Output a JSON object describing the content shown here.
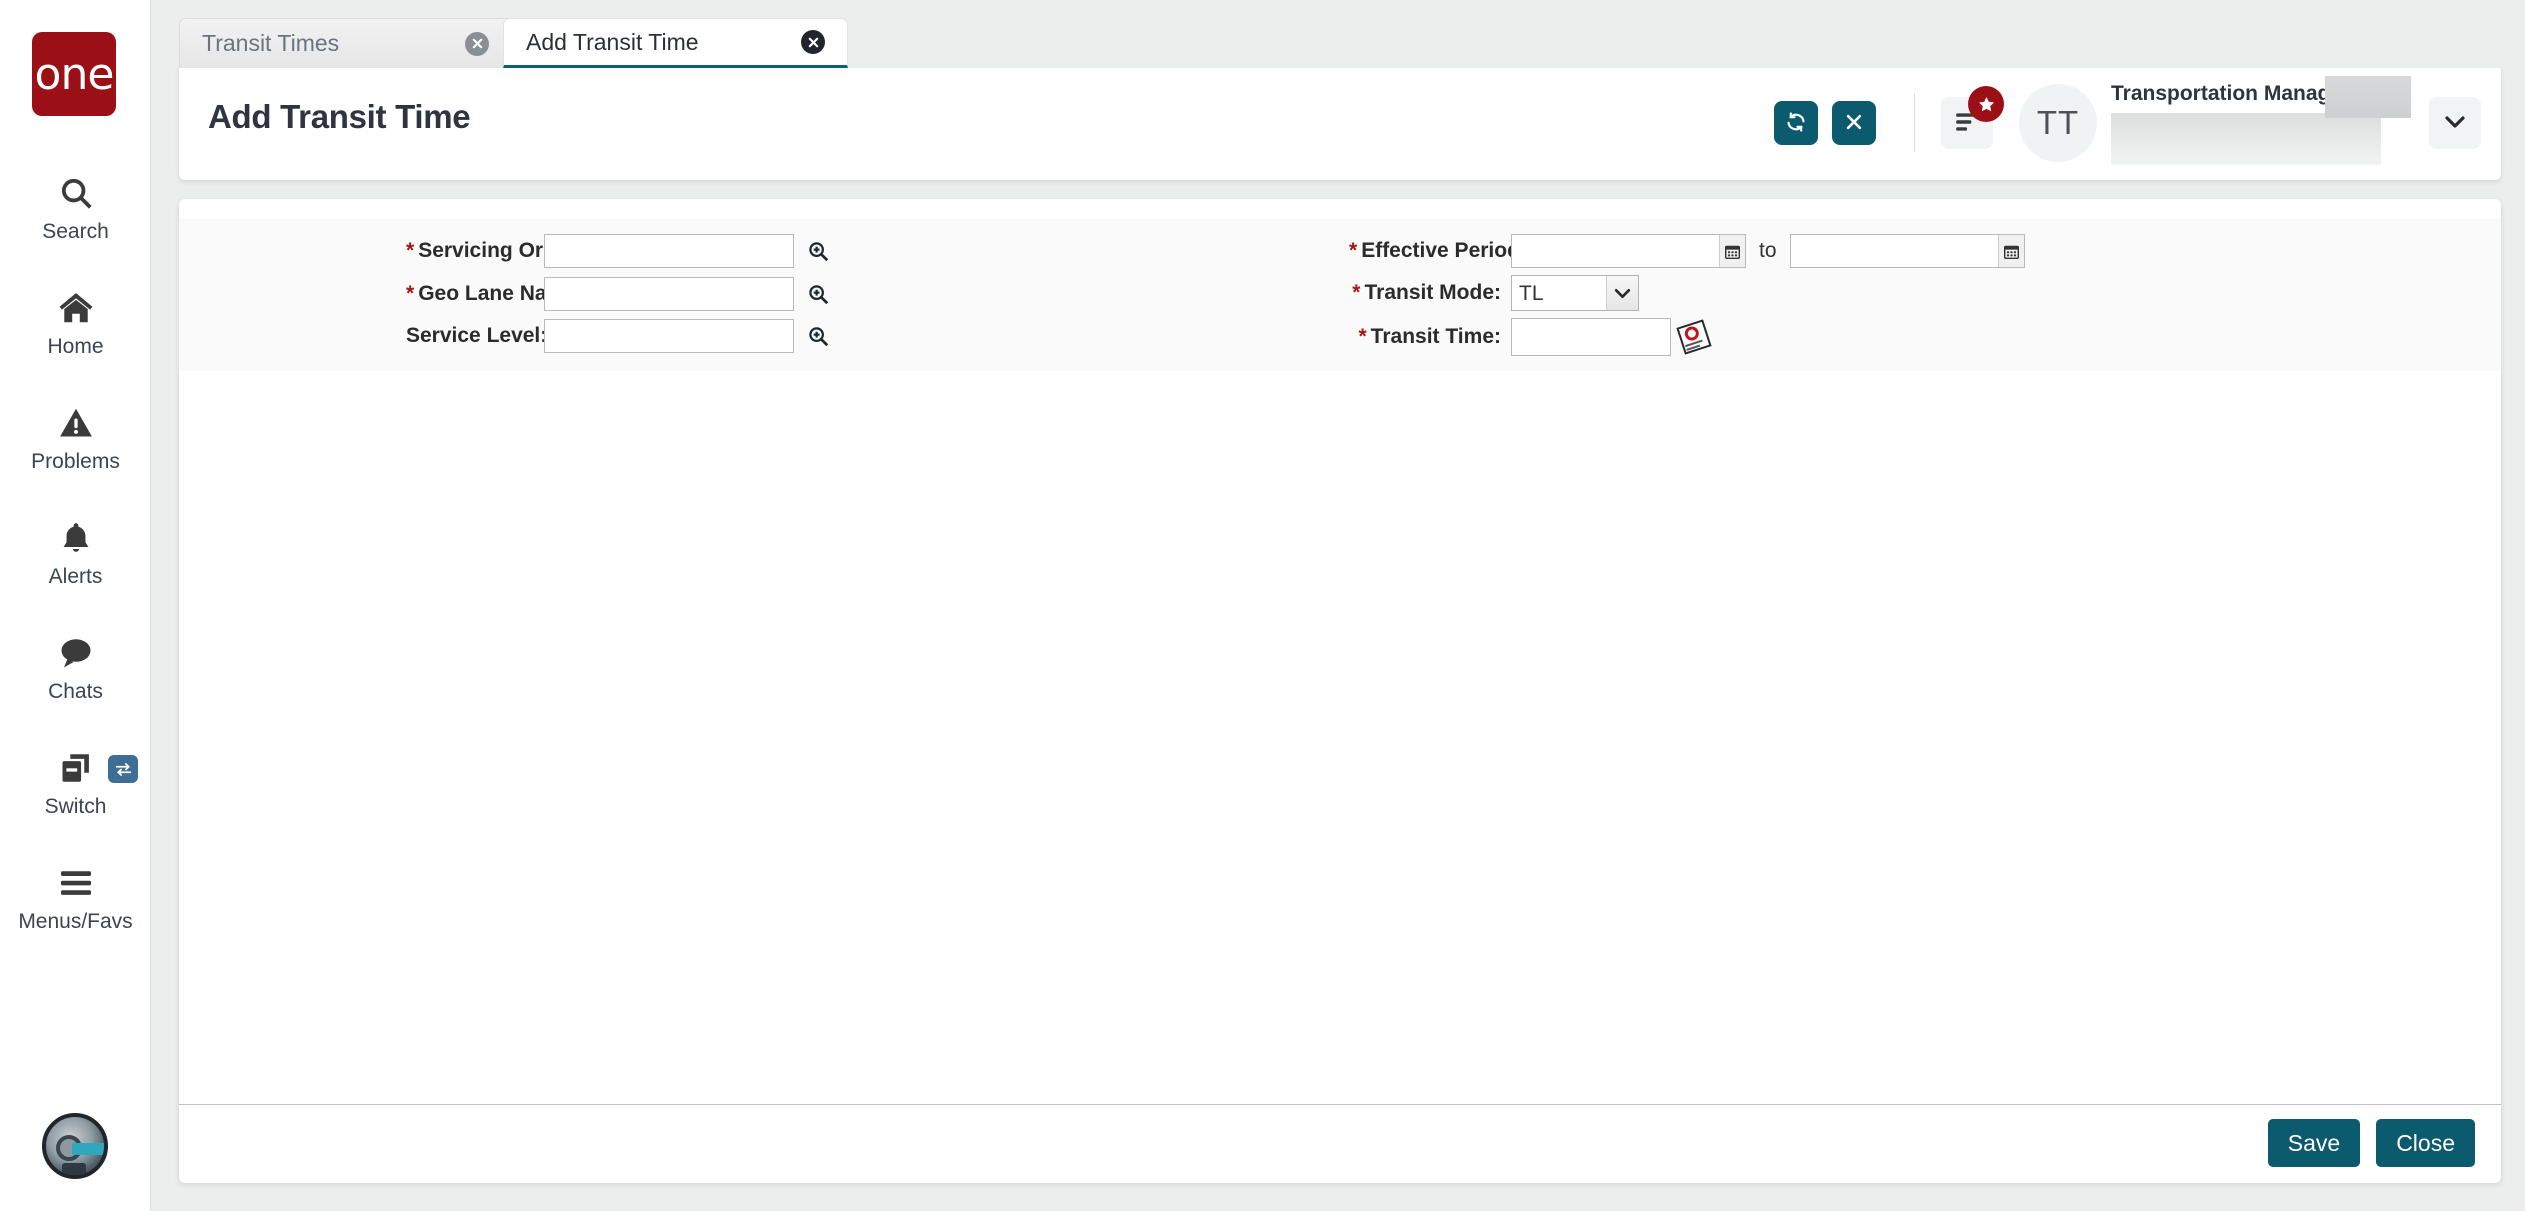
{
  "brand": {
    "logo_text": "one"
  },
  "sidebar": {
    "items": [
      {
        "label": "Search",
        "icon": "search-icon"
      },
      {
        "label": "Home",
        "icon": "home-icon"
      },
      {
        "label": "Problems",
        "icon": "warning-triangle-icon"
      },
      {
        "label": "Alerts",
        "icon": "bell-icon"
      },
      {
        "label": "Chats",
        "icon": "chat-bubble-icon"
      },
      {
        "label": "Switch",
        "icon": "switch-windows-icon",
        "badge_icon": "swap-arrows-icon"
      },
      {
        "label": "Menus/Favs",
        "icon": "hamburger-icon"
      }
    ],
    "assistant_avatar": "robot-avatar-icon"
  },
  "tabs": [
    {
      "label": "Transit Times",
      "active": false,
      "close_icon": "close-circle-icon"
    },
    {
      "label": "Add Transit Time",
      "active": true,
      "close_icon": "close-circle-icon"
    }
  ],
  "header": {
    "title": "Add Transit Time",
    "refresh_icon": "refresh-icon",
    "close_icon": "close-x-icon",
    "menu_icon": "list-menu-icon",
    "menu_badge_icon": "star-icon",
    "avatar_initials": "TT",
    "user_role": "Transportation Manager",
    "caret_icon": "chevron-down-icon"
  },
  "form": {
    "left_fields": [
      {
        "label": "Servicing Org:",
        "required": true,
        "value": "",
        "placeholder": "",
        "picker_icon": "search-plus-icon"
      },
      {
        "label": "Geo Lane Name:",
        "required": true,
        "value": "",
        "placeholder": "",
        "picker_icon": "search-plus-icon"
      },
      {
        "label": "Service Level:",
        "required": false,
        "value": "",
        "placeholder": "",
        "picker_icon": "search-plus-icon"
      }
    ],
    "effective_period": {
      "label": "Effective Period:",
      "required": true,
      "from_value": "",
      "to_label": "to",
      "to_value": "",
      "calendar_icon": "calendar-icon"
    },
    "transit_mode": {
      "label": "Transit Mode:",
      "required": true,
      "value": "TL",
      "options": [
        "TL"
      ],
      "caret_icon": "chevron-down-icon"
    },
    "transit_time": {
      "label": "Transit Time:",
      "required": true,
      "value": "",
      "picker_icon": "duration-picker-icon"
    }
  },
  "footer": {
    "save_label": "Save",
    "close_label": "Close"
  },
  "colors": {
    "brand_red": "#9b0f16",
    "accent_teal": "#0b5a6e",
    "required_red": "#a31515",
    "switch_badge_blue": "#3d6e96"
  }
}
